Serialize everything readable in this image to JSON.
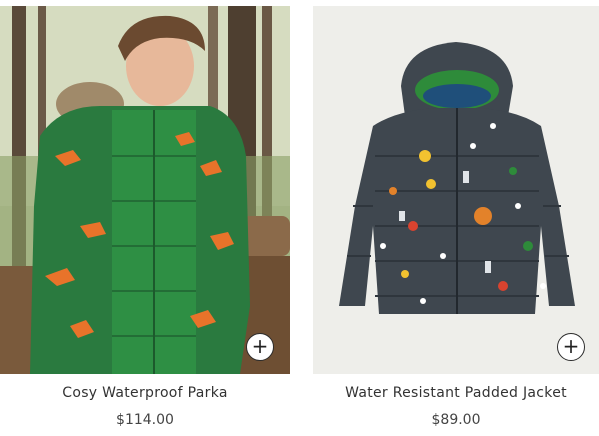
{
  "products": [
    {
      "title": "Cosy Waterproof Parka",
      "price": "$114.00",
      "add_label": "+",
      "image_subject": "boy-in-green-fox-print-parka",
      "colors": {
        "parka": "#2a7a3f",
        "fox": "#e8732a",
        "background": "#b8c49a"
      }
    },
    {
      "title": "Water Resistant Padded Jacket",
      "price": "$89.00",
      "add_label": "+",
      "image_subject": "grey-space-print-padded-jacket",
      "colors": {
        "jacket": "#3f474f",
        "lining": "#2e8b3a",
        "background": "#eeeeea"
      }
    }
  ]
}
